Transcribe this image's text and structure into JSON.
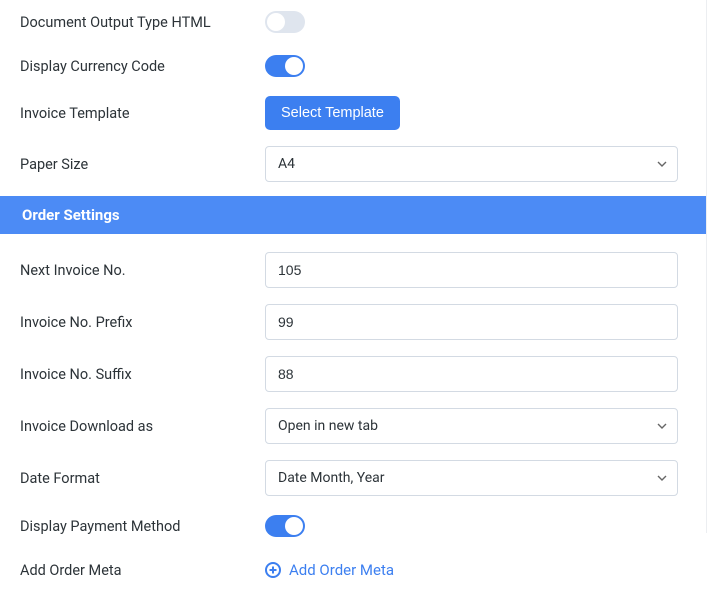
{
  "colors": {
    "accent": "#3c7ff0"
  },
  "settings": {
    "document_output_type_label": "Document Output Type HTML",
    "document_output_type_value": "off",
    "display_currency_code_label": "Display Currency Code",
    "display_currency_code_value": "on",
    "invoice_template_label": "Invoice Template",
    "invoice_template_button": "Select Template",
    "paper_size_label": "Paper Size",
    "paper_size_value": "A4"
  },
  "order_section_title": "Order Settings",
  "order": {
    "next_invoice_no_label": "Next Invoice No.",
    "next_invoice_no_value": "105",
    "invoice_no_prefix_label": "Invoice No. Prefix",
    "invoice_no_prefix_value": "99",
    "invoice_no_suffix_label": "Invoice No. Suffix",
    "invoice_no_suffix_value": "88",
    "invoice_download_as_label": "Invoice Download as",
    "invoice_download_as_value": "Open in new tab",
    "date_format_label": "Date Format",
    "date_format_value": "Date Month, Year",
    "display_payment_method_label": "Display Payment Method",
    "display_payment_method_value": "on",
    "add_order_meta_label": "Add Order Meta",
    "add_order_meta_link": "Add Order Meta"
  }
}
